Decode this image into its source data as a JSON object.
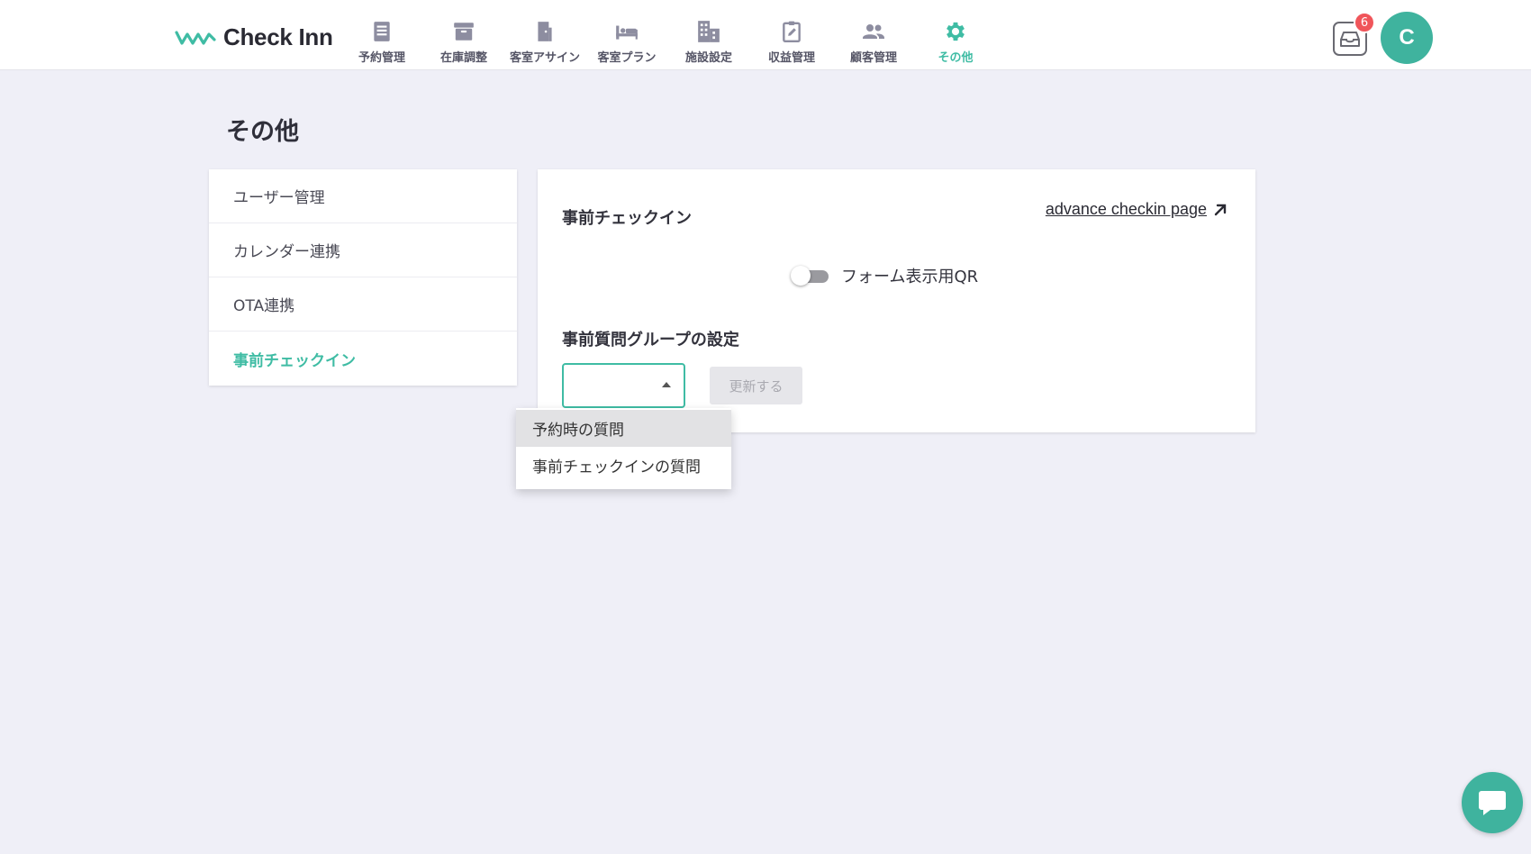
{
  "app": {
    "name": "Check Inn",
    "accent": "#3fbca4"
  },
  "nav": {
    "items": [
      {
        "label": "予約管理",
        "icon": "reservation-list-icon"
      },
      {
        "label": "在庫調整",
        "icon": "inventory-box-icon"
      },
      {
        "label": "客室アサイン",
        "icon": "door-icon"
      },
      {
        "label": "客室プラン",
        "icon": "bed-icon"
      },
      {
        "label": "施設設定",
        "icon": "building-icon"
      },
      {
        "label": "収益管理",
        "icon": "clipboard-edit-icon"
      },
      {
        "label": "顧客管理",
        "icon": "people-icon"
      },
      {
        "label": "その他",
        "icon": "gear-icon",
        "active": true
      }
    ]
  },
  "header": {
    "notification_count": "6",
    "avatar_initial": "C"
  },
  "page": {
    "title": "その他"
  },
  "sidebar": {
    "items": [
      {
        "label": "ユーザー管理"
      },
      {
        "label": "カレンダー連携"
      },
      {
        "label": "OTA連携"
      },
      {
        "label": "事前チェックイン",
        "active": true
      }
    ]
  },
  "panel": {
    "title": "事前チェックイン",
    "link_text": "advance checkin page",
    "toggle_label": "フォーム表示用QR",
    "toggle_on": false,
    "group_label": "事前質問グループの設定",
    "select_value": "",
    "update_button": "更新する"
  },
  "dropdown": {
    "options": [
      "予約時の質問",
      "事前チェックインの質問"
    ],
    "highlighted_index": 0
  }
}
